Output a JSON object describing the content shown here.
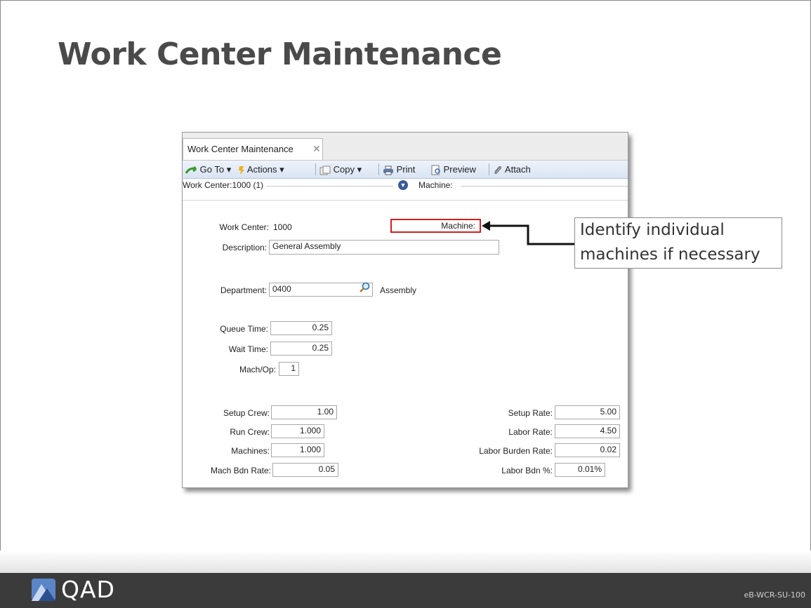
{
  "slide": {
    "title": "Work Center Maintenance",
    "doc_code": "eB-WCR-SU-100",
    "logo_text": "QAD"
  },
  "window": {
    "tab_label": "Work Center Maintenance",
    "toolbar": {
      "goto": "Go To",
      "actions": "Actions",
      "copy": "Copy",
      "print": "Print",
      "preview": "Preview",
      "attach": "Attach"
    },
    "header": {
      "work_center": "Work Center:1000 (1)",
      "machine": "Machine:"
    }
  },
  "form": {
    "work_center_label": "Work Center:",
    "work_center_value": "1000",
    "machine_label": "Machine:",
    "description_label": "Description:",
    "description_value": "General Assembly",
    "department_label": "Department:",
    "department_value": "0400",
    "department_desc": "Assembly",
    "queue_time_label": "Queue Time:",
    "queue_time_value": "0.25",
    "wait_time_label": "Wait Time:",
    "wait_time_value": "0.25",
    "mach_op_label": "Mach/Op:",
    "mach_op_value": "1",
    "setup_crew_label": "Setup Crew:",
    "setup_crew_value": "1.00",
    "run_crew_label": "Run Crew:",
    "run_crew_value": "1.000",
    "machines_label": "Machines:",
    "machines_value": "1.000",
    "mach_bdn_rate_label": "Mach Bdn Rate:",
    "mach_bdn_rate_value": "0.05",
    "setup_rate_label": "Setup Rate:",
    "setup_rate_value": "5.00",
    "labor_rate_label": "Labor Rate:",
    "labor_rate_value": "4.50",
    "labor_burden_rate_label": "Labor Burden Rate:",
    "labor_burden_rate_value": "0.02",
    "labor_bdn_pct_label": "Labor Bdn %:",
    "labor_bdn_pct_value": "0.01%"
  },
  "callout": {
    "line1": "Identify individual",
    "line2": "machines if necessary"
  },
  "colors": {
    "highlight": "#d42020",
    "footer": "#3b3b3b",
    "toolbar": "#d9e4f3"
  }
}
